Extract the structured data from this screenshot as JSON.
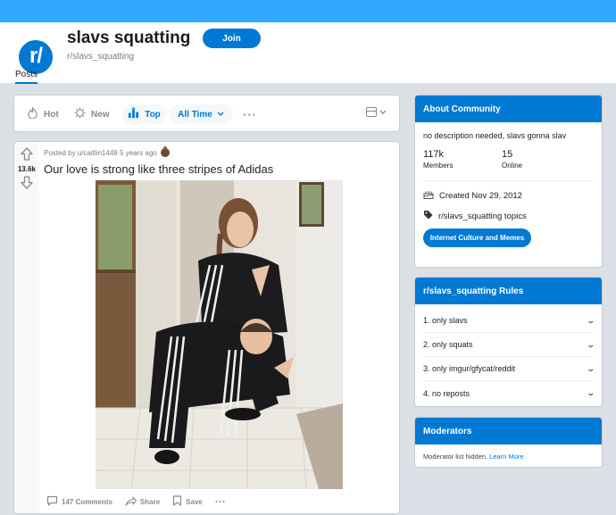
{
  "subreddit": {
    "title": "slavs squatting",
    "name": "r/slavs_squatting",
    "logo_text": "r/",
    "join_label": "Join",
    "tab_posts": "Posts"
  },
  "sort": {
    "hot": "Hot",
    "new": "New",
    "top": "Top",
    "time": "All Time",
    "more": "···"
  },
  "post": {
    "meta": "Posted by u/caitlin1448 5 years ago",
    "score": "13.6k",
    "title": "Our love is strong like three stripes of Adidas",
    "comments": "147 Comments",
    "share": "Share",
    "save": "Save",
    "more": "···"
  },
  "about": {
    "header": "About Community",
    "description": "no description needed, slavs gonna slav",
    "members_value": "117k",
    "members_label": "Members",
    "online_value": "15",
    "online_label": "Online",
    "created": "Created Nov 29, 2012",
    "topics": "r/slavs_squatting topics",
    "topic_chip": "Internet Culture and Memes"
  },
  "rules": {
    "header": "r/slavs_squatting Rules",
    "items": [
      "1. only slavs",
      "2. only squats",
      "3. only imgur/gfycat/reddit",
      "4. no reposts"
    ]
  },
  "moderators": {
    "header": "Moderators",
    "text": "Moderator list hidden.",
    "link": "Learn More"
  },
  "colors": {
    "brand_blue": "#0079d3",
    "banner_blue": "#33a8ff",
    "background": "#dae0e6"
  },
  "icons": [
    "subreddit-logo-icon",
    "hot-icon",
    "new-icon",
    "top-icon",
    "chevron-down-icon",
    "card-view-icon",
    "upvote-icon",
    "downvote-icon",
    "award-icon",
    "comment-icon",
    "share-icon",
    "save-icon",
    "cake-icon",
    "tag-icon"
  ]
}
